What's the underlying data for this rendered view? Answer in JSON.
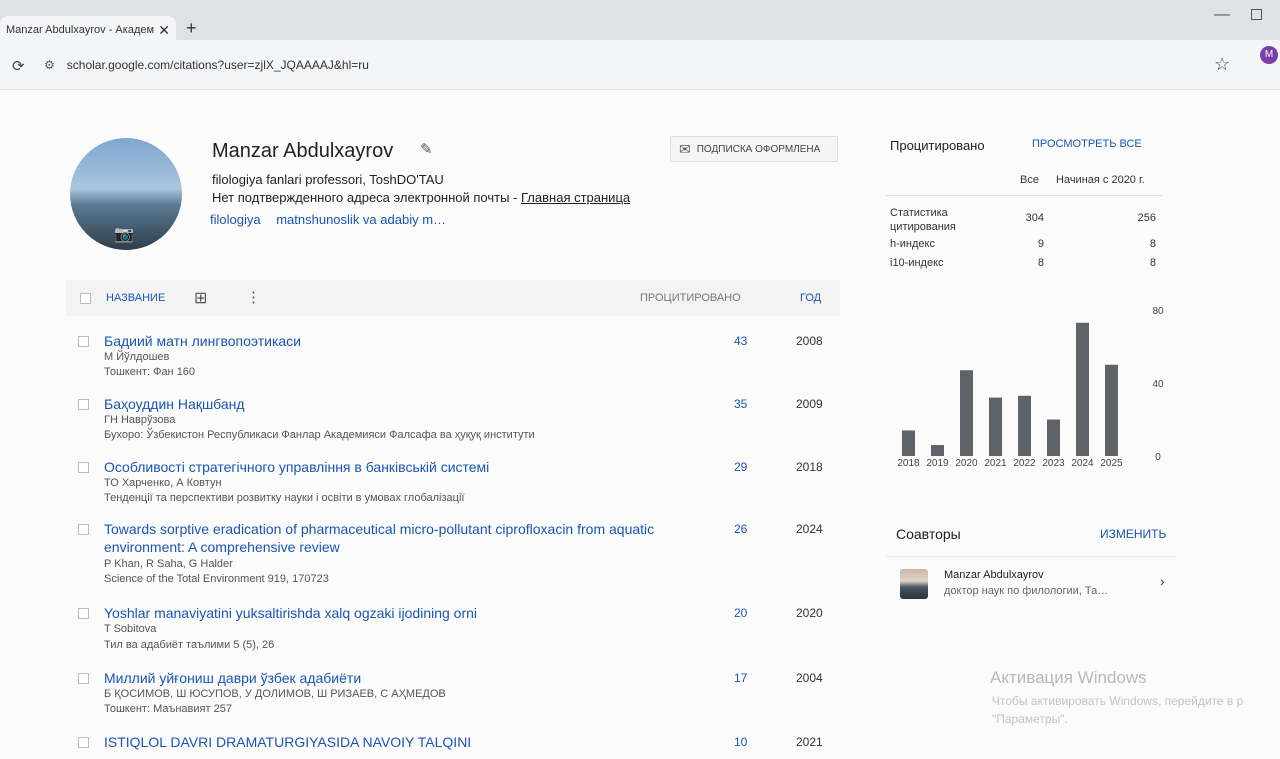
{
  "browser": {
    "tab_title": "Manzar Abdulxayrov - Академ",
    "tab_close": "✕",
    "new_tab": "+",
    "url": "scholar.google.com/citations?user=zjlX_JQAAAAJ&hl=ru",
    "profile_initial": "M"
  },
  "profile": {
    "name": "Manzar Abdulxayrov",
    "affiliation": "filologiya fanlari professori, ToshDO'TAU",
    "email_text": "Нет подтвержденного адреса электронной почты - ",
    "homepage_label": "Главная страница",
    "interests": [
      "filologiya",
      "matnshunoslik va adabiy m…"
    ],
    "subscribe_label": "ПОДПИСКА ОФОРМЛЕНА"
  },
  "table": {
    "col_title": "НАЗВАНИЕ",
    "col_cited": "ПРОЦИТИРОВАНО",
    "col_year": "ГОД",
    "rows": [
      {
        "title": "Бадиий матн лингвопоэтикаси",
        "authors": "М Йўлдошев",
        "venue": "Тошкент: Фан 160",
        "cites": "43",
        "year": "2008"
      },
      {
        "title": "Баҳоуддин Нақшбанд",
        "authors": "ГН Наврўзова",
        "venue": "Бухоро: Ўзбекистон Республикаси Фанлар Академияси Фалсафа ва ҳуқуқ институти",
        "cites": "35",
        "year": "2009"
      },
      {
        "title": "Особливості стратегічного управління в банківській системі",
        "authors": "ТО Харченко, А Ковтун",
        "venue": "Тенденції та перспективи розвитку науки і освіти в умовах глобалізації",
        "cites": "29",
        "year": "2018"
      },
      {
        "title": "Towards sorptive eradication of pharmaceutical micro-pollutant ciprofloxacin from aquatic environment: A comprehensive review",
        "authors": "P Khan, R Saha, G Halder",
        "venue": "Science of the Total Environment 919, 170723",
        "cites": "26",
        "year": "2024"
      },
      {
        "title": "Yoshlar manaviyatini yuksaltirishda xalq ogzaki ijodining orni",
        "authors": "T Sobitova",
        "venue": "Тил ва адабиёт таълими 5 (5), 26",
        "cites": "20",
        "year": "2020"
      },
      {
        "title": "Миллий уйғониш даври ўзбек адабиёти",
        "authors": "Б ҚОСИМОВ, Ш ЮСУПОВ, У ДОЛИМОВ, Ш РИЗАЕВ, С АҲМЕДОВ",
        "venue": "Тошкент: Маънавият 257",
        "cites": "17",
        "year": "2004"
      },
      {
        "title": "ISTIQLOL DAVRI DRAMATURGIYASIDA NAVOIY TALQINI",
        "authors": "",
        "venue": "",
        "cites": "10",
        "year": "2021"
      }
    ]
  },
  "sidebar": {
    "cited_title": "Процитировано",
    "view_all": "ПРОСМОТРЕТЬ ВСЕ",
    "col_all": "Все",
    "col_since": "Начиная с 2020 г.",
    "stats": [
      {
        "label": "Статистика цитирования",
        "all": "304",
        "since": "256"
      },
      {
        "label": "h-индекс",
        "all": "9",
        "since": "8"
      },
      {
        "label": "i10-индекс",
        "all": "8",
        "since": "8"
      }
    ],
    "coauthors_title": "Соавторы",
    "coauthors_edit": "ИЗМЕНИТЬ",
    "coauthor": {
      "name": "Manzar Abdulxayrov",
      "desc": "доктор наук по филологии, Та…"
    }
  },
  "chart_data": {
    "type": "bar",
    "categories": [
      "2018",
      "2019",
      "2020",
      "2021",
      "2022",
      "2023",
      "2024",
      "2025"
    ],
    "values": [
      14,
      6,
      47,
      32,
      33,
      20,
      73,
      50
    ],
    "ylim": [
      0,
      80
    ],
    "yticks": [
      "80",
      "40",
      "0"
    ],
    "bar_color": "#5f6368"
  },
  "watermark": {
    "title": "Активация Windows",
    "line1": "Чтобы активировать Windows, перейдите в р",
    "line2": "\"Параметры\"."
  }
}
